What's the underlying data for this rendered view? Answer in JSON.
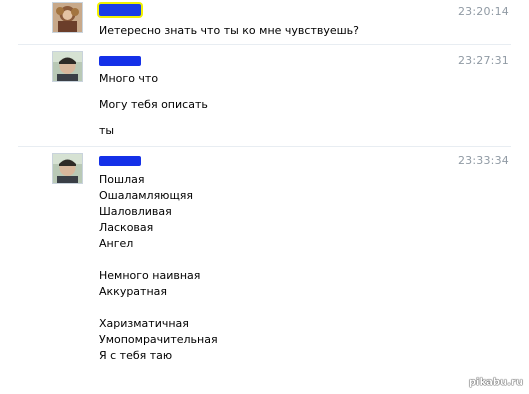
{
  "messages": [
    {
      "author_redacted": true,
      "avatar": "female-avatar-photo",
      "time": "23:20:14",
      "lines": [
        "Иетересно знать что ты ко мне чувствуешь?"
      ]
    },
    {
      "author_redacted": true,
      "avatar": "male-avatar-photo",
      "time": "23:27:31",
      "lines": [
        "Много что",
        "Могу тебя описать",
        "ты"
      ]
    },
    {
      "author_redacted": true,
      "avatar": "male-avatar-photo",
      "time": "23:33:34",
      "lines": [
        "Пошлая",
        "Ошаламляющяя",
        "Шаловливая",
        "Ласковая",
        "Ангел",
        "Немного наивная",
        "Аккуратная",
        "Харизматичная",
        "Умопомрачительная",
        "Я с тебя таю"
      ]
    }
  ],
  "watermark": "pikabu.ru",
  "colors": {
    "redaction_first": "#1a3de6",
    "redaction_highlight": "#f2f200",
    "redaction_others": "#1430e8",
    "timestamp": "#909aa4"
  }
}
